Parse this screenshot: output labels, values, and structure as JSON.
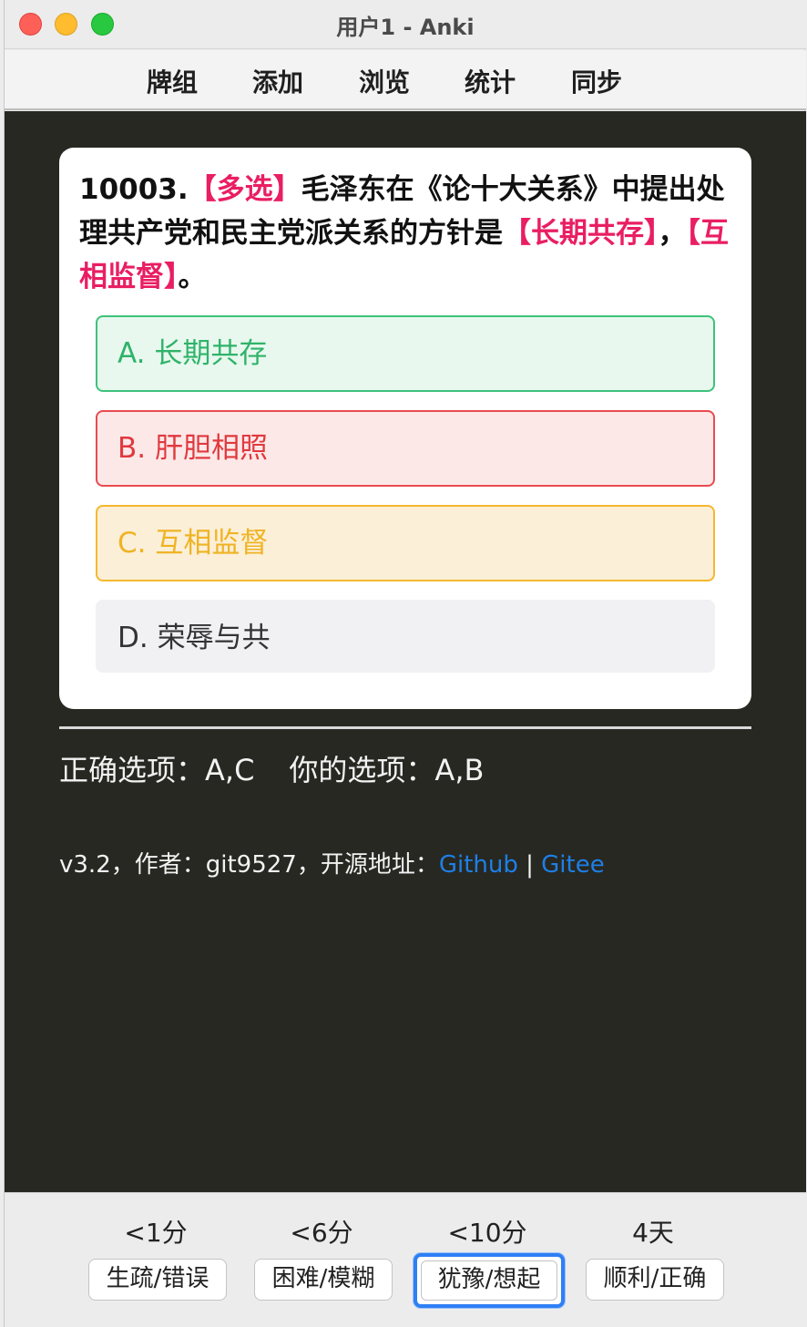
{
  "window": {
    "title": "用户1 - Anki"
  },
  "toolbar": {
    "items": [
      "牌组",
      "添加",
      "浏览",
      "统计",
      "同步"
    ]
  },
  "card": {
    "number": "10003.",
    "tag": "【多选】",
    "question_part1": "毛泽东在《论十大关系》中提出处理共产党和民主党派关系的方针是",
    "blank1": "【长期共存】",
    "comma": "，",
    "blank2": "【互相监督】",
    "period": "。",
    "options": [
      {
        "label": "A. 长期共存",
        "state": "correct-selected"
      },
      {
        "label": "B. 肝胆相照",
        "state": "wrong-selected"
      },
      {
        "label": "C. 互相监督",
        "state": "correct-missed"
      },
      {
        "label": "D. 荣辱与共",
        "state": "neutral"
      }
    ]
  },
  "result": {
    "correct": "正确选项：A,C",
    "yours": "你的选项：A,B"
  },
  "footer": {
    "text": "v3.2，作者：git9527，开源地址：",
    "github": "Github",
    "separator": " | ",
    "gitee": "Gitee"
  },
  "answer_bar": {
    "intervals": [
      "<1分",
      "<6分",
      "<10分",
      "4天"
    ],
    "buttons": [
      "生疏/错误",
      "困难/模糊",
      "犹豫/想起",
      "顺利/正确"
    ]
  },
  "colors": {
    "highlight": "#e91e63",
    "correct": "#2fb36a",
    "wrong": "#e0393e",
    "missed": "#f0b323",
    "link": "#1e7fe6",
    "background": "#272822"
  }
}
